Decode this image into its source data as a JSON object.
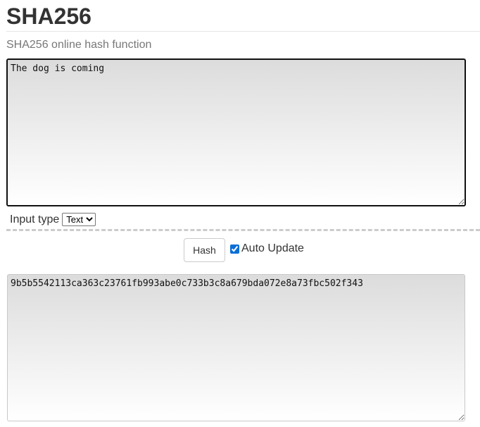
{
  "header": {
    "title": "SHA256",
    "subtitle": "SHA256 online hash function"
  },
  "input": {
    "value": "The dog is coming",
    "type_label": "Input type",
    "type_selected": "Text"
  },
  "controls": {
    "hash_label": "Hash",
    "auto_update_label": "Auto Update",
    "auto_update_checked": true
  },
  "output": {
    "value": "9b5b5542113ca363c23761fb993abe0c733b3c8a679bda072e8a73fbc502f343"
  }
}
